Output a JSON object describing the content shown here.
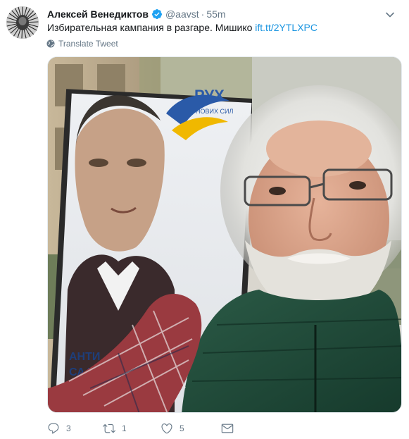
{
  "tweet": {
    "author_name": "Алексей Венедиктов",
    "handle": "@aavst",
    "separator": "·",
    "time": "55m",
    "text": "Избирательная кампания в разгаре. Мишико ",
    "link_text": "ift.tt/2YTLXPC",
    "translate_label": "Translate Tweet"
  },
  "photo": {
    "poster_brand": "РУХ",
    "poster_subtitle": "НОВИХ СИЛ",
    "poster_bottom_line1": "АНТИ",
    "poster_bottom_line2": "СААК"
  },
  "actions": {
    "reply_count": "3",
    "retweet_count": "1",
    "like_count": "5"
  },
  "icons": {
    "verified": "verified-badge-icon",
    "caret": "chevron-down-icon",
    "translate": "globe-icon",
    "reply": "reply-icon",
    "retweet": "retweet-icon",
    "like": "heart-icon",
    "dm": "envelope-icon"
  },
  "colors": {
    "link": "#1b95e0",
    "muted": "#657786",
    "text": "#14171a",
    "verified": "#1da1f2"
  }
}
